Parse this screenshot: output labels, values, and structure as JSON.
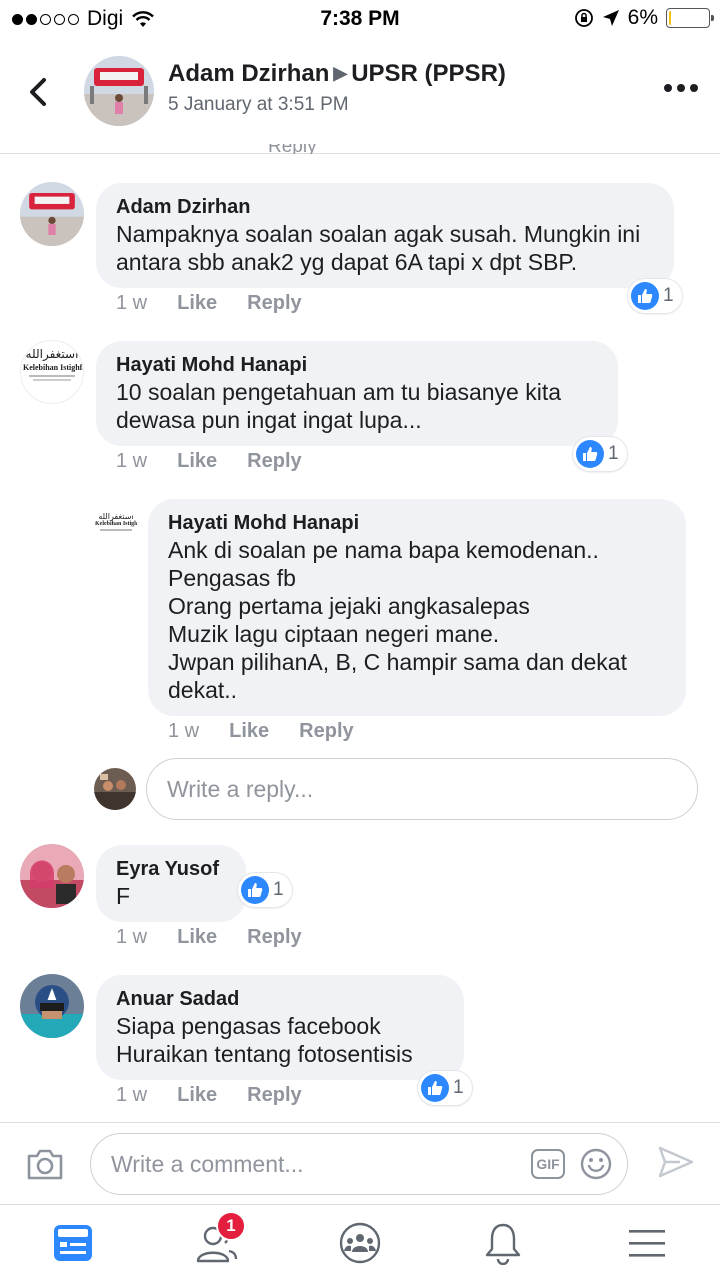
{
  "status_bar": {
    "carrier": "Digi",
    "signal_bars_filled": 2,
    "signal_bars_total": 5,
    "time": "7:38 PM",
    "battery_percent": "6%",
    "battery_level": 0.06
  },
  "header": {
    "author": "Adam Dzirhan",
    "group": "UPSR (PPSR)",
    "timestamp": "5 January at 3:51 PM",
    "back_icon": "chevron-left-icon",
    "more_icon": "more-dots-icon"
  },
  "comments": [
    {
      "author": "Adam Dzirhan",
      "text": "Nampaknya soalan soalan agak susah. Mungkin ini antara sbb anak2 yg dapat 6A tapi x dpt SBP.",
      "time": "1 w",
      "like_label": "Like",
      "reply_label": "Reply",
      "reactions": "1"
    },
    {
      "author": "Hayati Mohd Hanapi",
      "text": "10 soalan pengetahuan am tu biasanye kita dewasa pun ingat ingat lupa...",
      "time": "1 w",
      "like_label": "Like",
      "reply_label": "Reply",
      "reactions": "1",
      "avatar_caption": "Kelebihan Istighfa",
      "avatar_arabic": "أستغفرالله"
    },
    {
      "author": "Hayati Mohd Hanapi",
      "text": "Ank di soalan pe nama bapa kemodenan..\nPengasas fb\nOrang pertama jejaki angkasalepas\nMuzik lagu ciptaan negeri mane.\nJwpan pilihanA, B, C hampir sama dan dekat dekat..",
      "time": "1 w",
      "like_label": "Like",
      "reply_label": "Reply",
      "avatar_caption": "Kelebihan Istighfa",
      "avatar_arabic": "أستغفرالله"
    },
    {
      "author": "Eyra Yusof",
      "text": "F",
      "time": "1 w",
      "like_label": "Like",
      "reply_label": "Reply",
      "reactions": "1"
    },
    {
      "author": "Anuar Sadad",
      "text": "Siapa pengasas facebook\nHuraikan tentang fotosentisis",
      "time": "1 w",
      "like_label": "Like",
      "reply_label": "Reply",
      "reactions": "1"
    }
  ],
  "reply_placeholder": "Write a reply...",
  "composer": {
    "placeholder": "Write a comment...",
    "gif_label": "GIF"
  },
  "tabbar": {
    "friends_badge": "1",
    "tabs": [
      "news-feed-icon",
      "friend-requests-icon",
      "groups-icon",
      "notifications-icon",
      "menu-icon"
    ]
  },
  "colors": {
    "accent": "#2d88ff",
    "bubble": "#f0f2f5",
    "meta_text": "#90949c",
    "badge": "#e41e3f"
  }
}
